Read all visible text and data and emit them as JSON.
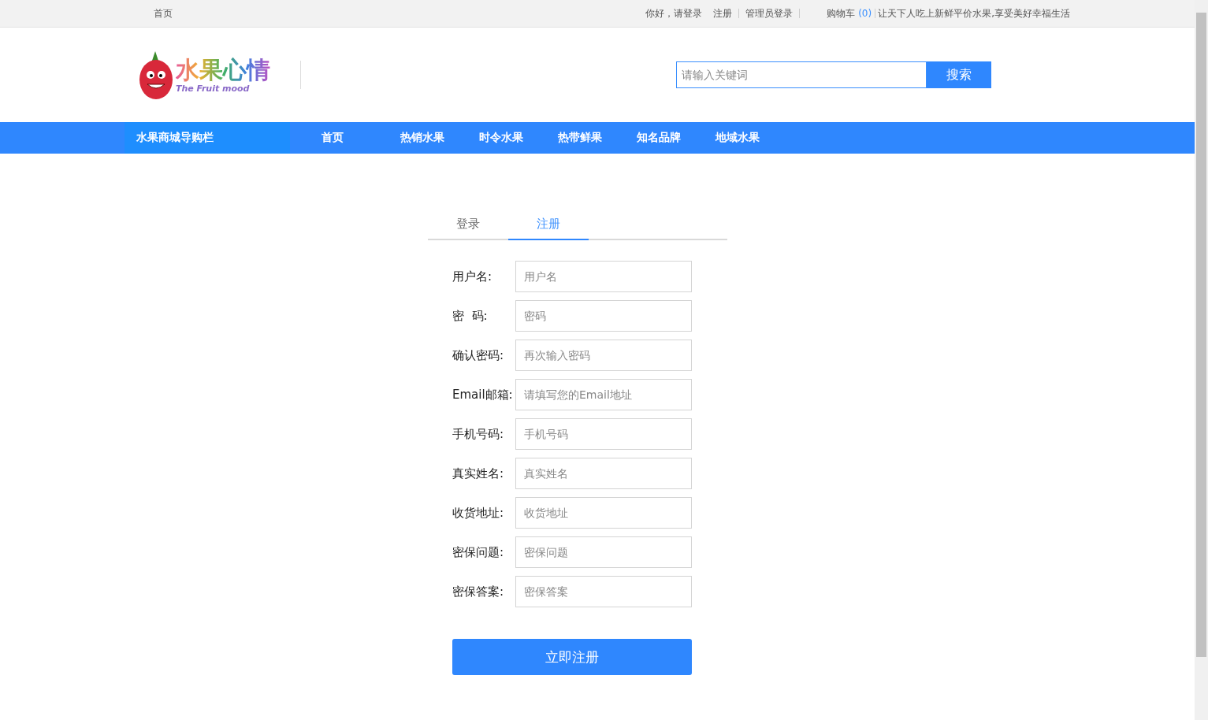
{
  "top_bar": {
    "home": "首页",
    "greeting": "你好，请登录",
    "links": [
      "注册",
      "管理员登录"
    ],
    "cart_label": "购物车",
    "cart_count": "(0)",
    "slogan": "让天下人吃上新鲜平价水果,享受美好幸福生活"
  },
  "logo": {
    "title": "水果心情",
    "subtitle": "The Fruit mood"
  },
  "search": {
    "placeholder": "请输入关键词",
    "button": "搜索"
  },
  "nav": {
    "category_title": "水果商城导购栏",
    "items": [
      "首页",
      "热销水果",
      "时令水果",
      "热带鲜果",
      "知名品牌",
      "地域水果"
    ]
  },
  "tabs": [
    {
      "label": "登录",
      "selected": false
    },
    {
      "label": "注册",
      "selected": true
    }
  ],
  "form": {
    "fields": [
      {
        "label": "用户名:",
        "placeholder": "用户名"
      },
      {
        "label": "密  码:",
        "placeholder": "密码"
      },
      {
        "label": "确认密码:",
        "placeholder": "再次输入密码"
      },
      {
        "label": "Email邮箱:",
        "placeholder": "请填写您的Email地址"
      },
      {
        "label": "手机号码:",
        "placeholder": "手机号码"
      },
      {
        "label": "真实姓名:",
        "placeholder": "真实姓名"
      },
      {
        "label": "收货地址:",
        "placeholder": "收货地址"
      },
      {
        "label": "密保问题:",
        "placeholder": "密保问题"
      },
      {
        "label": "密保答案:",
        "placeholder": "密保答案"
      }
    ],
    "submit": "立即注册"
  }
}
